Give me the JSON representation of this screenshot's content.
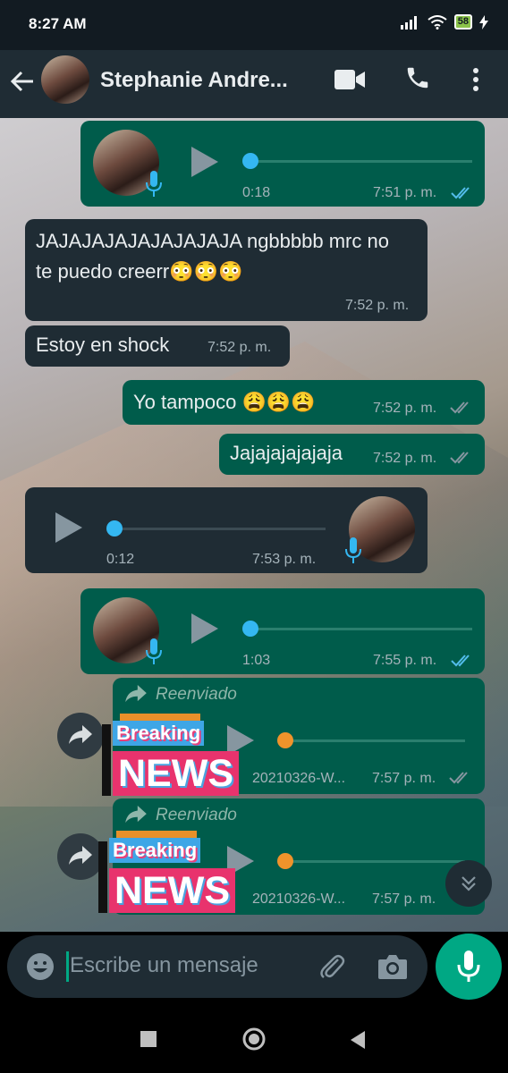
{
  "status_bar": {
    "time": "8:27 AM",
    "battery": "58"
  },
  "header": {
    "contact_name": "Stephanie Andre..."
  },
  "messages": {
    "voice1": {
      "duration": "0:18",
      "time": "7:51 p. m.",
      "progress": 0.0
    },
    "text1": {
      "text": "JAJAJAJAJAJAJAJAJA ngbbbbb mrc no te puedo creerr😳😳😳",
      "time": "7:52 p. m."
    },
    "text2": {
      "text": "Estoy en shock",
      "time": "7:52 p. m."
    },
    "text3": {
      "text": "Yo tampoco 😩😩😩",
      "time": "7:52 p. m."
    },
    "text4": {
      "text": "Jajajajajajaja",
      "time": "7:52 p. m."
    },
    "voice2": {
      "duration": "0:12",
      "time": "7:53 p. m.",
      "progress": 0.0
    },
    "voice3": {
      "duration": "1:03",
      "time": "7:55 p. m.",
      "progress": 0.0
    },
    "fwd1": {
      "label": "Reenviado",
      "badge_top": "Breaking",
      "badge_bottom": "NEWS",
      "filename": "20210326-W...",
      "time": "7:57 p. m."
    },
    "fwd2": {
      "label": "Reenviado",
      "badge_top": "Breaking",
      "badge_bottom": "NEWS",
      "filename": "20210326-W...",
      "time": "7:57 p. m."
    }
  },
  "input": {
    "placeholder": "Escribe un mensaje"
  },
  "icons": [
    "back-arrow-icon",
    "video-call-icon",
    "phone-icon",
    "more-vert-icon",
    "play-icon",
    "mic-icon",
    "double-check-icon",
    "forward-icon",
    "emoji-icon",
    "attach-icon",
    "camera-icon",
    "chevron-double-down-icon",
    "nav-square-icon",
    "nav-circle-icon",
    "nav-back-icon"
  ],
  "colors": {
    "outgoing_bubble": "#005c4b",
    "incoming_bubble": "#1f2c34",
    "read_ticks": "#53bdeb",
    "accent": "#00a884"
  }
}
